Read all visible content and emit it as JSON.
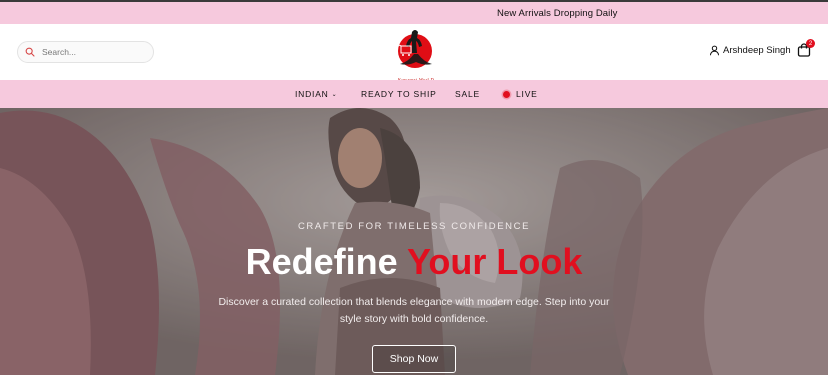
{
  "announcement": {
    "text": "New Arrivals Dropping Daily"
  },
  "header": {
    "search": {
      "placeholder": "Search..."
    },
    "logo": {
      "text": "Kuwaarsi Worl D"
    },
    "account": {
      "name": "Arshdeep Singh"
    },
    "cart": {
      "count": "2"
    }
  },
  "nav": {
    "items": [
      {
        "label": "INDIAN",
        "has_dropdown": true
      },
      {
        "label": "READY TO SHIP"
      },
      {
        "label": "SALE"
      },
      {
        "label": "LIVE",
        "live_indicator": true
      }
    ]
  },
  "hero": {
    "eyebrow": "CRAFTED FOR TIMELESS CONFIDENCE",
    "headline_white": "Redefine",
    "headline_red": "Your Look",
    "description": "Discover a curated collection that blends elegance with modern edge. Step into your style story with bold confidence.",
    "cta_label": "Shop Now"
  },
  "colors": {
    "pink_band": "#f6c9dd",
    "accent_red": "#e10f1f",
    "text": "#111111"
  },
  "icons": [
    "search-icon",
    "user-icon",
    "bag-icon",
    "chevron-down-icon",
    "live-dot-icon"
  ]
}
